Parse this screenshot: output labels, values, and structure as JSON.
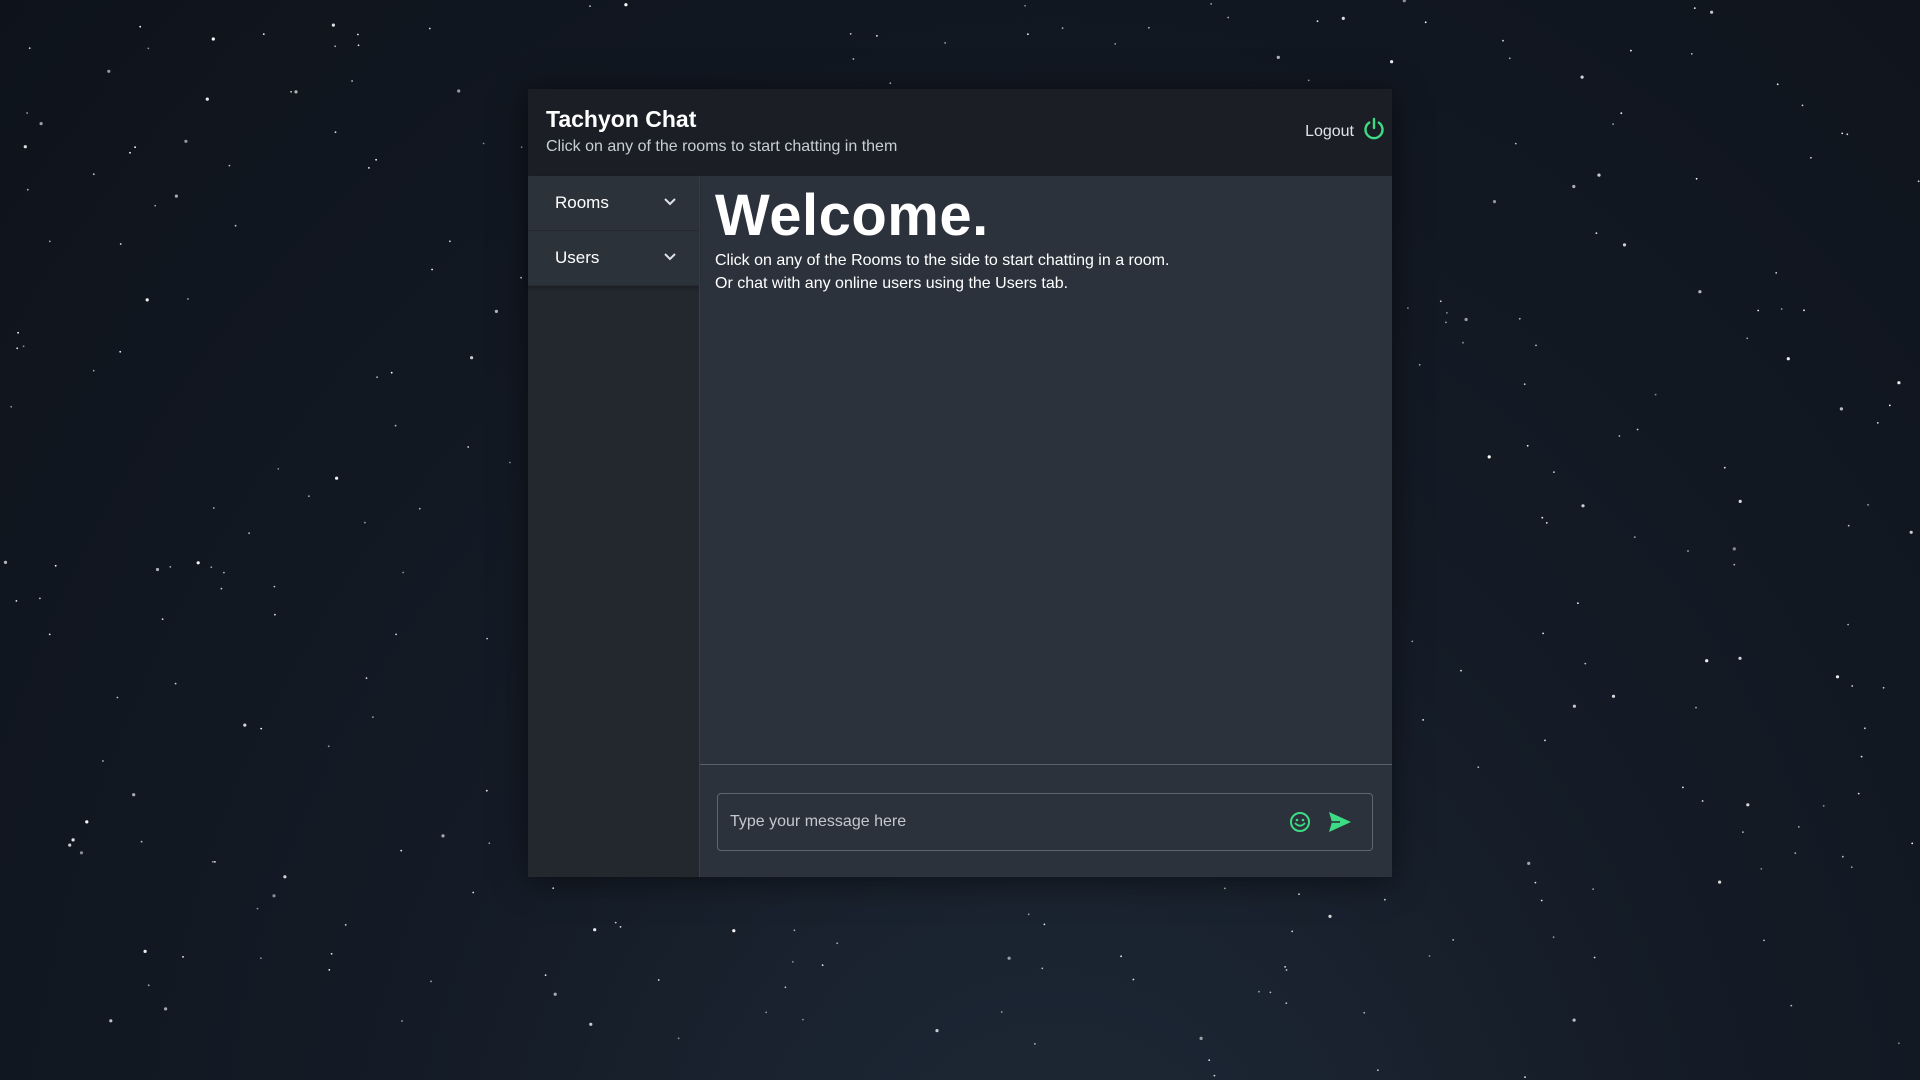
{
  "app": {
    "title": "Tachyon Chat",
    "subtitle": "Click on any of the rooms to start chatting in them",
    "logout_label": "Logout"
  },
  "sidebar": {
    "items": [
      {
        "label": "Rooms",
        "icon": "chevron-down-icon"
      },
      {
        "label": "Users",
        "icon": "chevron-down-icon"
      }
    ]
  },
  "main": {
    "heading": "Welcome.",
    "line1": "Click on any of the Rooms to the side to start chatting in a room.",
    "line2": "Or chat with any online users using the Users tab."
  },
  "composer": {
    "placeholder": "Type your message here",
    "emoji_icon": "smiley-icon",
    "send_icon": "send-icon"
  },
  "colors": {
    "accent": "#3ddc84",
    "header_bg": "#1b1f25",
    "panel_bg": "#2c323c",
    "sidebar_bg": "#23282f"
  }
}
